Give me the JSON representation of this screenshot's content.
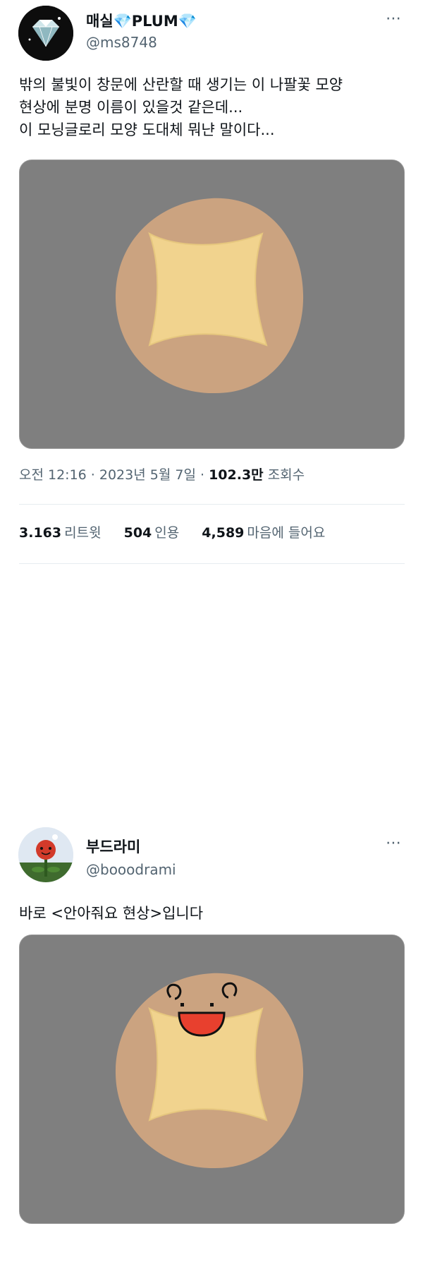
{
  "tweet1": {
    "display_name": "매실💎PLUM💎",
    "handle": "@ms8748",
    "more_icon": "⋯",
    "text_lines": [
      "밖의 불빛이 창문에 산란할 때 생기는 이 나팔꽃 모양",
      "현상에 분명 이름이 있을것 같은데...",
      "이 모닝글로리 모양 도대체 뭐냔 말이다..."
    ],
    "meta": {
      "time_date": "오전 12:16 · 2023년 5월 7일 ·",
      "views": "102.3만",
      "views_label": "조회수"
    },
    "stats": {
      "retweets": "3.163",
      "retweets_label": "리트윗",
      "quotes": "504",
      "quotes_label": "인용",
      "likes": "4,589",
      "likes_label": "마음에 들어요"
    },
    "media": {
      "background": "#7f7f7f",
      "blob_color": "#cba380",
      "star_color": "#f1d38e"
    }
  },
  "tweet2": {
    "display_name": "부드라미",
    "handle": "@booodrami",
    "more_icon": "⋯",
    "text": "바로 <안아줘요 현상>입니다",
    "media": {
      "background": "#7f7f7f",
      "blob_color": "#cba380",
      "star_color": "#f1d38e",
      "mouth_color": "#e8402e"
    }
  }
}
